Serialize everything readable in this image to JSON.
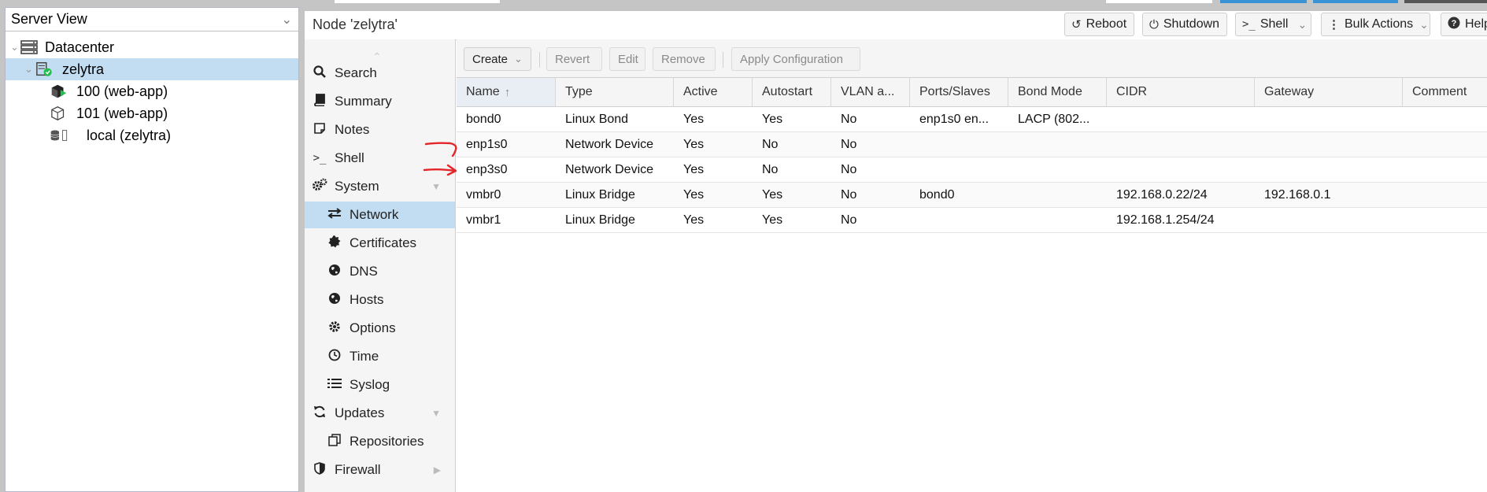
{
  "view_selector": {
    "label": "Server View"
  },
  "tree": {
    "items": [
      {
        "label": "Datacenter",
        "icon": "server-rack-icon"
      },
      {
        "label": "zelytra",
        "icon": "node-online-icon"
      },
      {
        "label": "100 (web-app)",
        "icon": "vm-running-icon"
      },
      {
        "label": "101 (web-app)",
        "icon": "vm-stopped-icon"
      },
      {
        "label": "local (zelytra)",
        "icon": "storage-icon"
      }
    ]
  },
  "node_header": {
    "title": "Node 'zelytra'",
    "buttons": {
      "reboot": "Reboot",
      "shutdown": "Shutdown",
      "shell": "Shell",
      "bulk": "Bulk Actions",
      "help": "Help"
    }
  },
  "nav": {
    "items": [
      {
        "label": "Search",
        "icon": "search-icon"
      },
      {
        "label": "Summary",
        "icon": "book-icon"
      },
      {
        "label": "Notes",
        "icon": "note-icon"
      },
      {
        "label": "Shell",
        "icon": "terminal-icon"
      },
      {
        "label": "System",
        "icon": "gears-icon"
      },
      {
        "label": "Network",
        "icon": "exchange-icon"
      },
      {
        "label": "Certificates",
        "icon": "certificate-icon"
      },
      {
        "label": "DNS",
        "icon": "globe-icon"
      },
      {
        "label": "Hosts",
        "icon": "globe-icon"
      },
      {
        "label": "Options",
        "icon": "gear-icon"
      },
      {
        "label": "Time",
        "icon": "clock-icon"
      },
      {
        "label": "Syslog",
        "icon": "list-icon"
      },
      {
        "label": "Updates",
        "icon": "refresh-icon"
      },
      {
        "label": "Repositories",
        "icon": "copy-icon"
      },
      {
        "label": "Firewall",
        "icon": "shield-icon"
      }
    ]
  },
  "toolbar": {
    "create": "Create",
    "revert": "Revert",
    "edit": "Edit",
    "remove": "Remove",
    "apply": "Apply Configuration"
  },
  "grid": {
    "columns": [
      "Name",
      "Type",
      "Active",
      "Autostart",
      "VLAN a...",
      "Ports/Slaves",
      "Bond Mode",
      "CIDR",
      "Gateway",
      "Comment"
    ],
    "rows": [
      [
        "bond0",
        "Linux Bond",
        "Yes",
        "Yes",
        "No",
        "enp1s0 en...",
        "LACP (802...",
        "",
        "",
        ""
      ],
      [
        "enp1s0",
        "Network Device",
        "Yes",
        "No",
        "No",
        "",
        "",
        "",
        "",
        ""
      ],
      [
        "enp3s0",
        "Network Device",
        "Yes",
        "No",
        "No",
        "",
        "",
        "",
        "",
        ""
      ],
      [
        "vmbr0",
        "Linux Bridge",
        "Yes",
        "Yes",
        "No",
        "bond0",
        "",
        "192.168.0.22/24",
        "192.168.0.1",
        ""
      ],
      [
        "vmbr1",
        "Linux Bridge",
        "Yes",
        "Yes",
        "No",
        "",
        "",
        "192.168.1.254/24",
        "",
        ""
      ]
    ]
  },
  "colors": {
    "selection": "#c2ddf2",
    "running": "#21bf4b",
    "annotation": "#e3262b"
  }
}
